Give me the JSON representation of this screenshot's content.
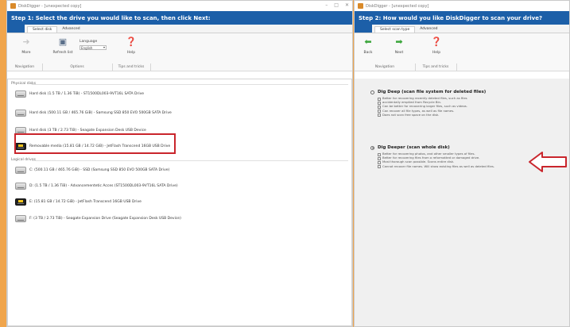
{
  "colors": {
    "accent": "#1c5fa8",
    "background": "#f0a54c",
    "highlight": "#c9252c"
  },
  "left_window": {
    "title": "DiskDigger - [unexpected copy]",
    "step": "Step 1: Select the drive you would like to scan, then click Next:",
    "tabs": [
      "Select disk",
      "Advanced"
    ],
    "buttons": {
      "more": "More",
      "refresh": "Refresh list",
      "help": "Help"
    },
    "language_label": "Language",
    "language_value": "English",
    "groups": {
      "navigation": "Navigation",
      "options": "Options",
      "tips": "Tips and tricks"
    },
    "physical_label": "Physical disks",
    "physical": [
      "Hard disk (1.5 TB / 1.36 TiB) - ST1500DL003-9VT16L SATA Drive",
      "Hard disk (500.11 GB / 465.76 GiB) - Samsung SSD 850 EVO 500GB SATA Drive",
      "Hard disk (3 TB / 2.73 TiB) - Seagate Expansion Desk USB Device",
      "Removable media (15.81 GB / 14.72 GiB) - JetFlash Transcend 16GB USB Drive"
    ],
    "logical_label": "Logical drives",
    "logical": [
      "C: (500.11 GB / 465.76 GiB) - SSD (Samsung SSD 850 EVO 500GB SATA Drive)",
      "D: (1.5 TB / 1.36 TiB) - Advancementetic Acces (ST1500DL003-9VT16L SATA Drive)",
      "E: (15.81 GB / 14.72 GiB) - JetFlash Transcend 16GB USB Drive",
      "F: (3 TB / 2.73 TiB) - Seagate Expansion Drive (Seagate Expansion Desk USB Device)"
    ]
  },
  "right_window": {
    "title": "DiskDigger - [unexpected copy]",
    "step": "Step 2: How would you like DiskDigger to scan your drive?",
    "tabs": [
      "Select scan type",
      "Advanced"
    ],
    "buttons": {
      "back": "Back",
      "next": "Next",
      "help": "Help"
    },
    "groups": {
      "navigation": "Navigation",
      "tips": "Tips and tricks"
    },
    "option1": {
      "title": "Dig Deep (scan file system for deleted files)",
      "bullets": [
        "Better for recovering recently deleted files, such as files",
        "accidentally emptied from Recycle Bin.",
        "Can be better for recovering larger files, such as videos.",
        "Can recover all file types, as well as file names.",
        "Does not scan free space on the disk."
      ]
    },
    "option2": {
      "title": "Dig Deeper (scan whole disk)",
      "bullets": [
        "Better for recovering photos, and other smaller types of files.",
        "Better for recovering files from a reformatted or damaged drive.",
        "Most thorough scan possible. Scans entire disk.",
        "Cannot recover file names. Will show existing files as well as deleted files."
      ]
    }
  }
}
